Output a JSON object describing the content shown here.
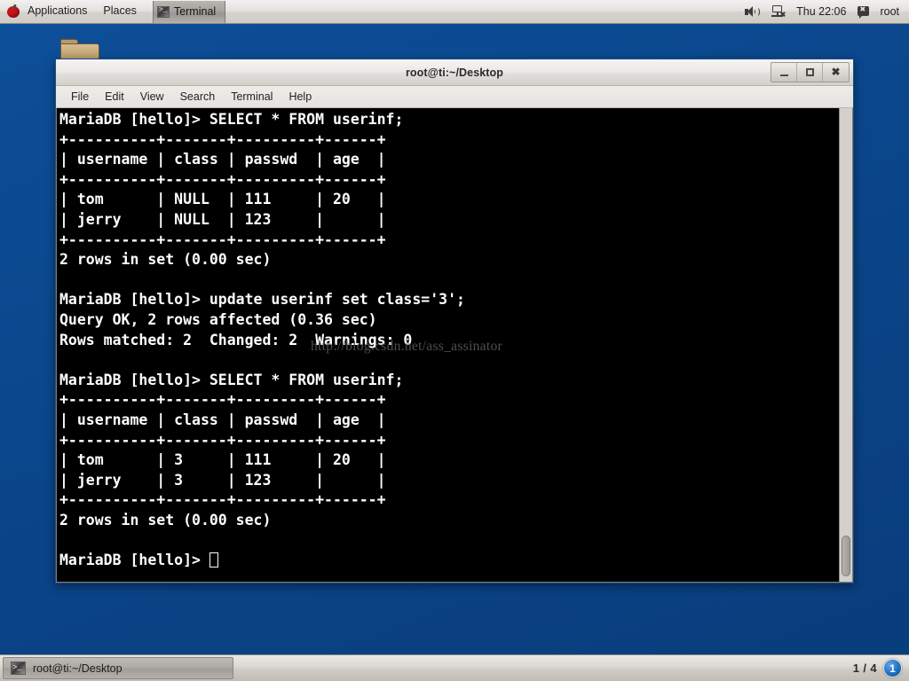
{
  "top_panel": {
    "logo_icon": "fedora-logo-icon",
    "applications_label": "Applications",
    "places_label": "Places",
    "window_button": {
      "label": "Terminal",
      "icon": "terminal-icon"
    },
    "tray": {
      "volume_icon": "speaker-icon",
      "network_icon": "network-disconnected-icon",
      "clock": "Thu 22:06",
      "user_icon": "user-icon",
      "user_label": "root"
    }
  },
  "desktop": {
    "folder_icon": "folder-icon"
  },
  "window": {
    "title": "root@ti:~/Desktop",
    "controls": {
      "minimize": "minimize-icon",
      "maximize": "maximize-icon",
      "close": "close-icon"
    },
    "menu": [
      "File",
      "Edit",
      "View",
      "Search",
      "Terminal",
      "Help"
    ],
    "watermark": "http://blog.csdn.net/ass_assinator",
    "terminal_lines": [
      "MariaDB [hello]> SELECT * FROM userinf;",
      "+----------+-------+---------+------+",
      "| username | class | passwd  | age  |",
      "+----------+-------+---------+------+",
      "| tom      | NULL  | 111     | 20   |",
      "| jerry    | NULL  | 123     |      |",
      "+----------+-------+---------+------+",
      "2 rows in set (0.00 sec)",
      "",
      "MariaDB [hello]> update userinf set class='3';",
      "Query OK, 2 rows affected (0.36 sec)",
      "Rows matched: 2  Changed: 2  Warnings: 0",
      "",
      "MariaDB [hello]> SELECT * FROM userinf;",
      "+----------+-------+---------+------+",
      "| username | class | passwd  | age  |",
      "+----------+-------+---------+------+",
      "| tom      | 3     | 111     | 20   |",
      "| jerry    | 3     | 123     |      |",
      "+----------+-------+---------+------+",
      "2 rows in set (0.00 sec)",
      "",
      "MariaDB [hello]> "
    ],
    "prompt": "MariaDB [hello]> ",
    "db_tables": [
      {
        "query": "SELECT * FROM userinf;",
        "columns": [
          "username",
          "class",
          "passwd",
          "age"
        ],
        "rows": [
          [
            "tom",
            "NULL",
            "111",
            "20"
          ],
          [
            "jerry",
            "NULL",
            "123",
            ""
          ]
        ],
        "result": "2 rows in set (0.00 sec)"
      },
      {
        "query": "SELECT * FROM userinf;",
        "columns": [
          "username",
          "class",
          "passwd",
          "age"
        ],
        "rows": [
          [
            "tom",
            "3",
            "111",
            "20"
          ],
          [
            "jerry",
            "3",
            "123",
            ""
          ]
        ],
        "result": "2 rows in set (0.00 sec)"
      }
    ],
    "update_statement": {
      "query": "update userinf set class='3';",
      "status": "Query OK, 2 rows affected (0.36 sec)",
      "summary": "Rows matched: 2  Changed: 2  Warnings: 0"
    }
  },
  "bottom_panel": {
    "task_button": {
      "label": "root@ti:~/Desktop",
      "icon": "terminal-icon"
    },
    "workspace_count": "1 / 4",
    "workspace_current": "1"
  },
  "colors": {
    "desktop_blue": "#0b4b93",
    "panel_grey": "#d6d3ce",
    "terminal_bg": "#000000",
    "terminal_fg": "#ffffff",
    "accent_blue": "#1f6fc4"
  }
}
